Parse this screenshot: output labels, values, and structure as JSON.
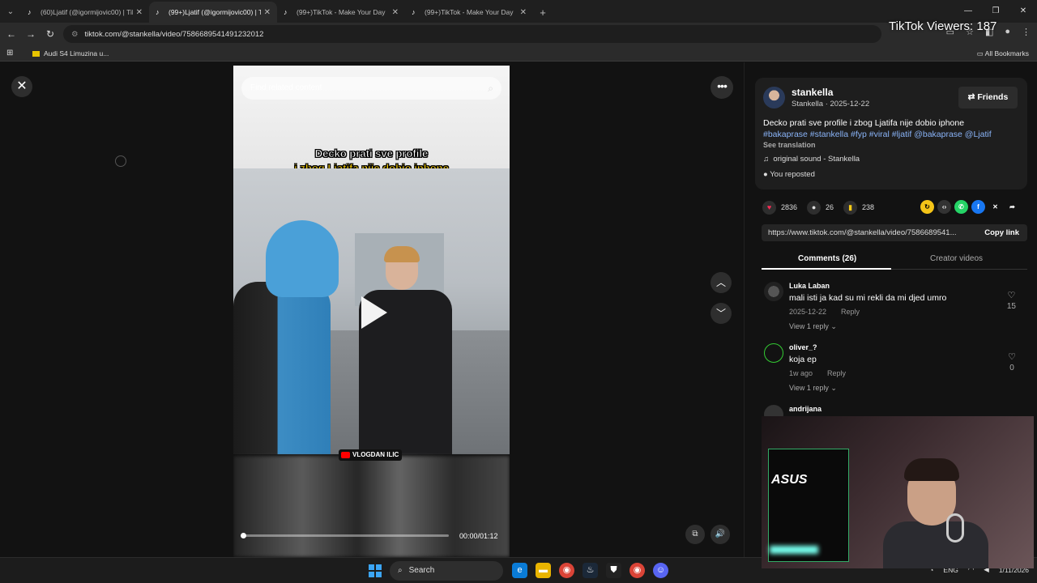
{
  "browser": {
    "tabs": [
      {
        "title": "(60)Ljatif (@igormijovic00) | Tik",
        "active": false
      },
      {
        "title": "(99+)Ljatif (@igormijovic00) | T",
        "active": true
      },
      {
        "title": "(99+)TikTok - Make Your Day",
        "active": false
      },
      {
        "title": "(99+)TikTok - Make Your Day",
        "active": false
      }
    ],
    "url": "tiktok.com/@stankella/video/7586689541491232012",
    "bookmark": "Audi S4 Limuzina u...",
    "all_bookmarks": "All Bookmarks"
  },
  "overlay": {
    "viewers": "TikTok Viewers: 187"
  },
  "video": {
    "search_placeholder": "Find related content",
    "caption_line1": "Decko prati sve profile",
    "caption_line2": "i zbog Ljatifa nije dobio iphone",
    "watermark": "VLOGDAN ILIC",
    "time": "00:00/01:12",
    "progress": 0
  },
  "post": {
    "username": "stankella",
    "meta": "Stankella · 2025-12-22",
    "friends_label": "Friends",
    "description": "Decko prati sve profile i zbog Ljatifa nije dobio iphone",
    "hashtags": "#bakaprase #stankella #fyp #viral #ljatif @bakaprase @Ljatif",
    "see_translation": "See translation",
    "sound": "original sound - Stankella",
    "reposted": "You reposted",
    "likes": "2836",
    "comments": "26",
    "saves": "238",
    "link": "https://www.tiktok.com/@stankella/video/7586689541...",
    "copy_link": "Copy link"
  },
  "tabs": {
    "comments": "Comments (26)",
    "creator": "Creator videos"
  },
  "comments": [
    {
      "name": "Luka Laban",
      "text": "mali isti ja kad su mi rekli da mi djed umro",
      "date": "2025-12-22",
      "reply": "Reply",
      "view": "View 1 reply",
      "likes": "15"
    },
    {
      "name": "oliver_?",
      "text": "koja ep",
      "date": "1w ago",
      "reply": "Reply",
      "view": "View 1 reply",
      "likes": "0"
    },
    {
      "name": "andrijana",
      "text": "",
      "date": "",
      "reply": "",
      "view": "",
      "likes": ""
    }
  ],
  "taskbar": {
    "search": "Search",
    "lang": "ENG",
    "date": "1/11/2026"
  },
  "colors": {
    "accent": "#fe2c55",
    "link": "#8ab4f8"
  }
}
